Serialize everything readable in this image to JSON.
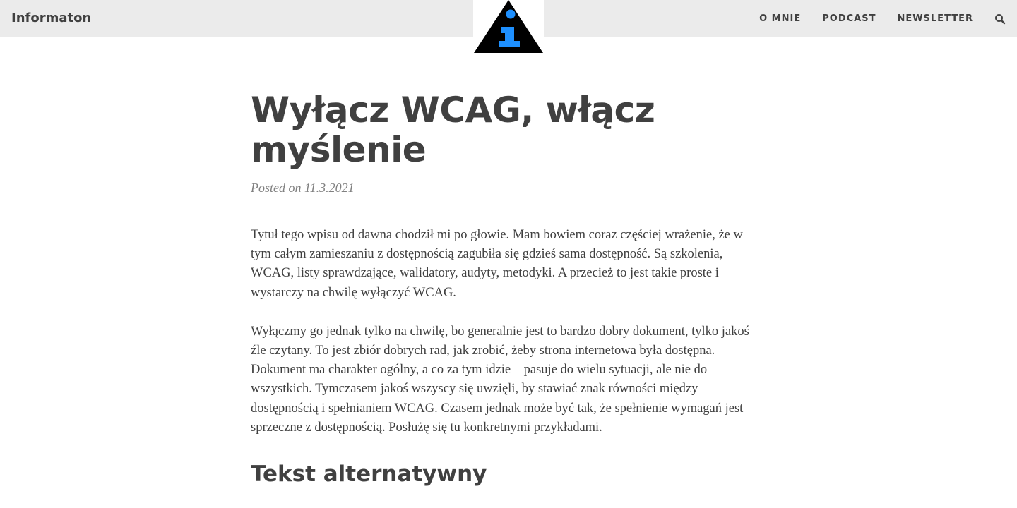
{
  "header": {
    "brand": "Informaton",
    "logo_icon": "info-icon",
    "nav": [
      {
        "label": "O MNIE"
      },
      {
        "label": "PODCAST"
      },
      {
        "label": "NEWSLETTER"
      }
    ],
    "search_icon": "search-icon"
  },
  "article": {
    "title": "Wyłącz WCAG, włącz myślenie",
    "meta": "Posted on 11.3.2021",
    "paragraphs": [
      "Tytuł tego wpisu od dawna chodził mi po głowie. Mam bowiem coraz częściej wrażenie, że w tym całym zamieszaniu z dostępnością zagubiła się gdzieś sama dostępność. Są szkolenia, WCAG, listy sprawdzające, walidatory, audyty, metodyki. A przecież to jest takie proste i wystarczy na chwilę wyłączyć WCAG.",
      "Wyłączmy go jednak tylko na chwilę, bo generalnie jest to bardzo dobry dokument, tylko jakoś źle czytany. To jest zbiór dobrych rad, jak zrobić, żeby strona internetowa była dostępna. Dokument ma charakter ogólny, a co za tym idzie – pasuje do wielu sytuacji, ale nie do wszystkich. Tymczasem jakoś wszyscy się uwzięli, by stawiać znak równości między dostępnością i spełnianiem WCAG. Czasem jednak może być tak, że spełnienie wymagań jest sprzeczne z dostępnością. Posłużę się tu konkretnymi przykładami."
    ],
    "subheading": "Tekst alternatywny"
  },
  "colors": {
    "topbar_bg": "#ebebeb",
    "text": "#404040",
    "meta": "#808080",
    "logo_triangle": "#000000",
    "logo_i": "#1e90ff"
  }
}
